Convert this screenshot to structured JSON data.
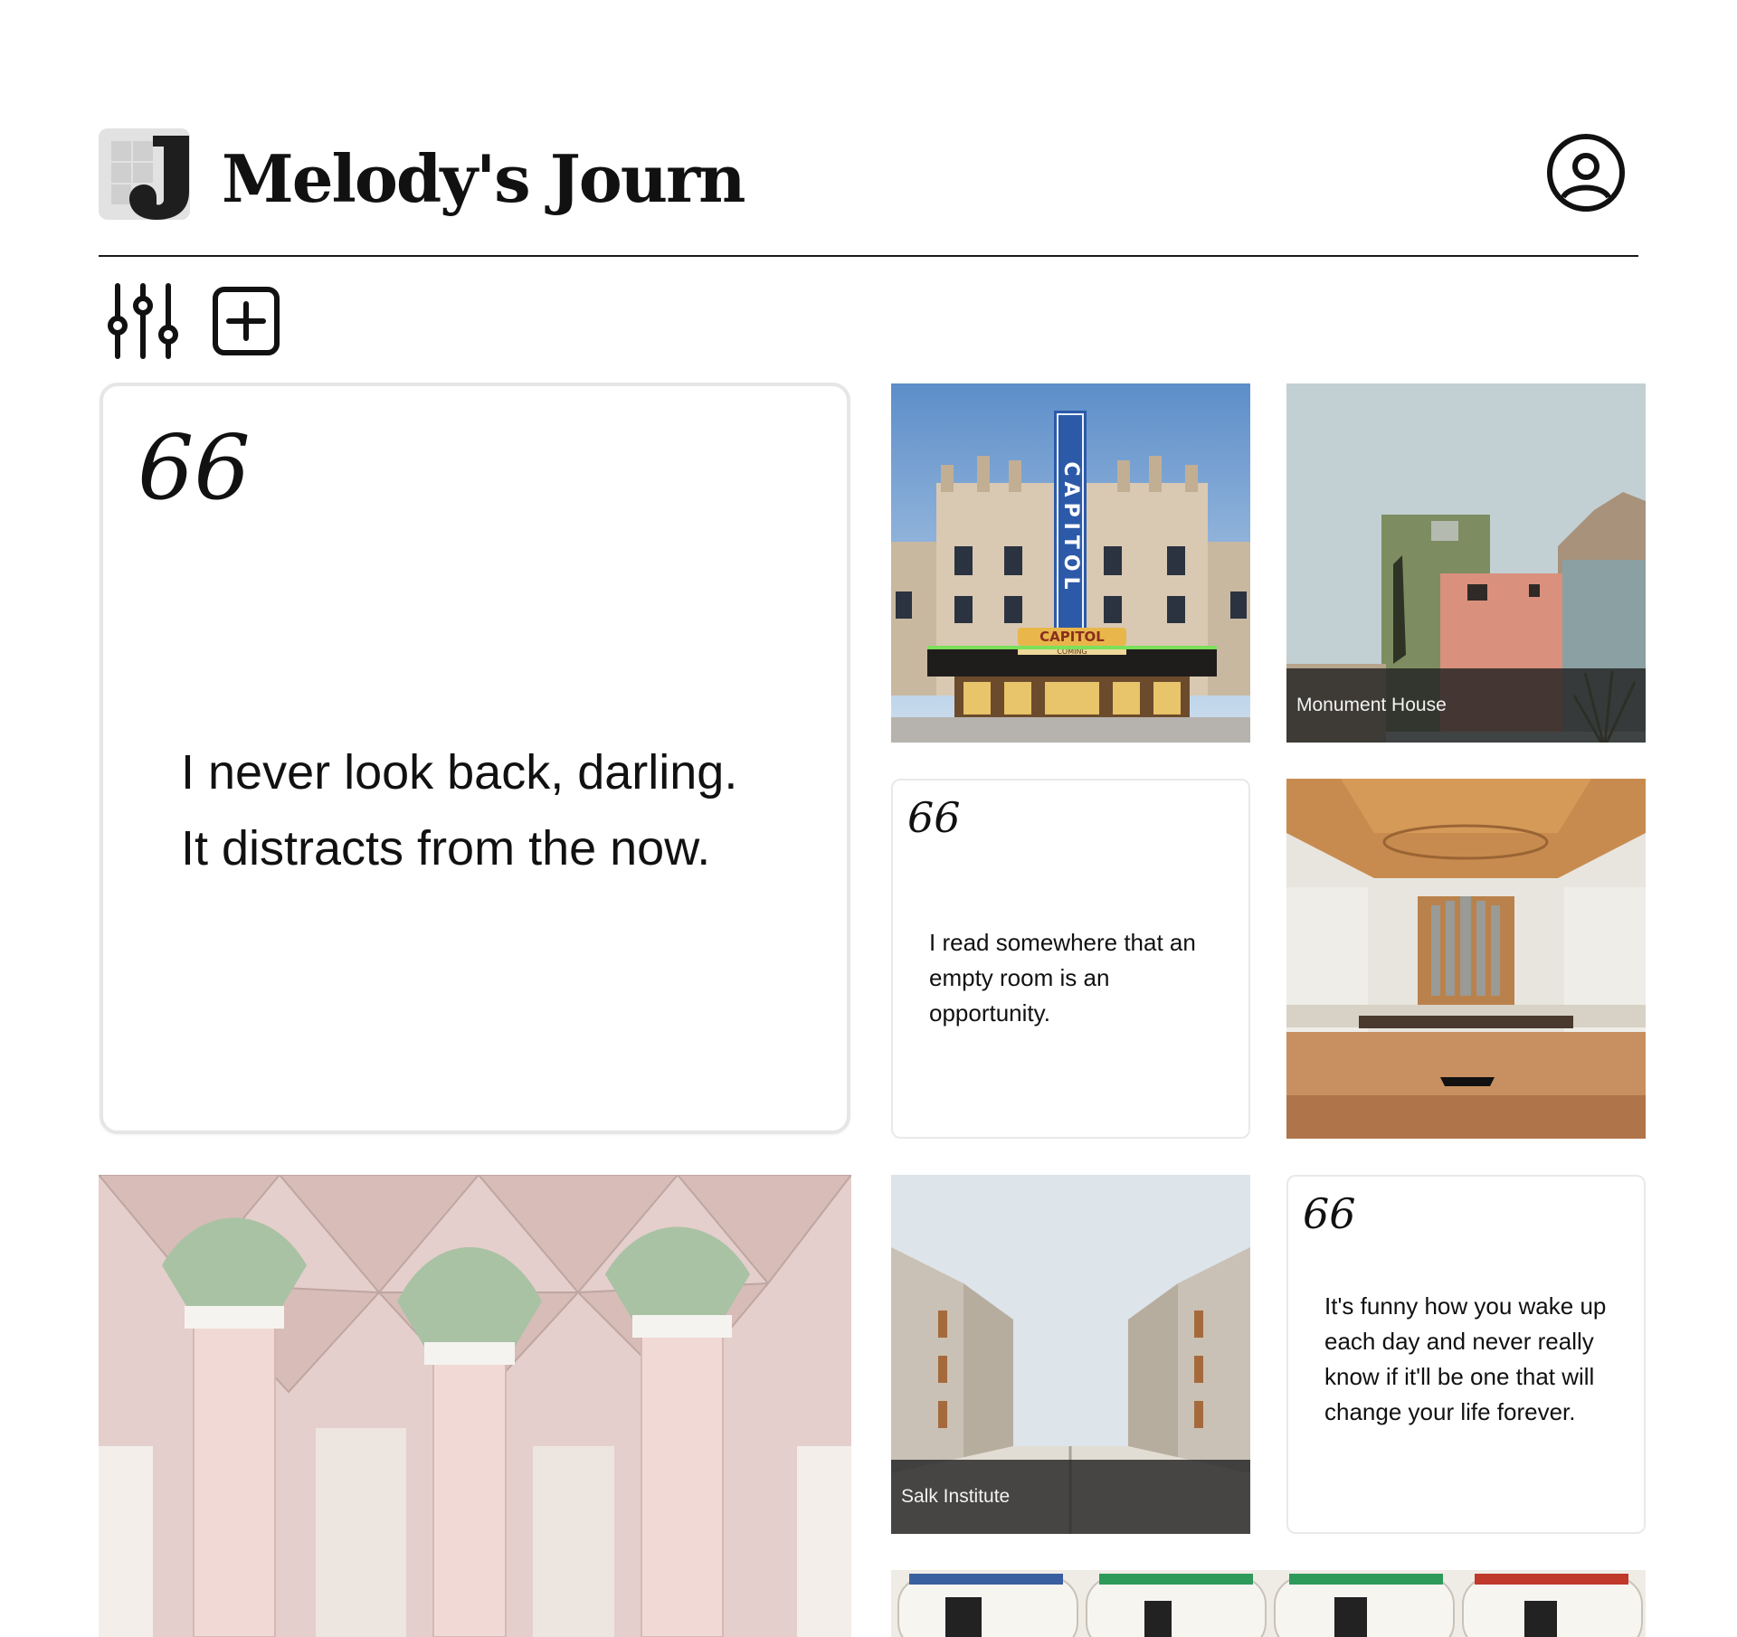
{
  "header": {
    "title": "Melody's Journ",
    "logo_letter": "J",
    "logo_icon": "journal-logo-icon",
    "profile_icon": "user-circle-icon"
  },
  "toolbar": {
    "filter_icon": "sliders-icon",
    "add_icon": "plus-square-icon"
  },
  "cards": {
    "quote_main": {
      "mark": "66",
      "text_line1": "I never look back, darling.",
      "text_line2": "It distracts from the now."
    },
    "photo_capitol": {
      "sign_text": "CAPITOL",
      "marquee_text": "CAPITOL",
      "marquee_sub": "COMING"
    },
    "photo_monument": {
      "caption": "Monument House"
    },
    "quote_room": {
      "mark": "66",
      "text": "I read somewhere that an empty room is an opportunity."
    },
    "photo_concert_hall": {},
    "photo_cathedral": {},
    "photo_salk": {
      "caption": "Salk Institute"
    },
    "quote_funny": {
      "mark": "66",
      "text": "It's funny how you wake up each day and never really know if it'll be one that will change your life forever."
    },
    "photo_barrels": {}
  },
  "colors": {
    "text": "#111111",
    "rule": "#1a1a1a",
    "card_border": "#e6e6e6",
    "caption_bg": "#232323"
  }
}
